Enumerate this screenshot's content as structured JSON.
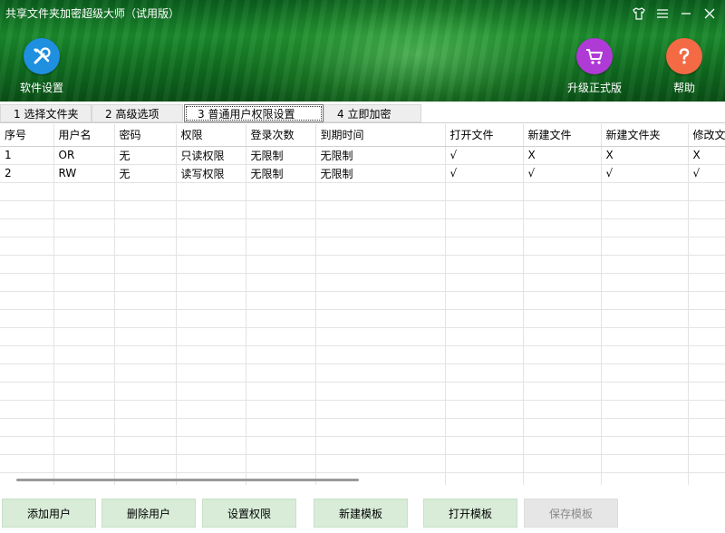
{
  "window": {
    "title": "共享文件夹加密超级大师（试用版）"
  },
  "toolbar": {
    "settings_label": "软件设置",
    "upgrade_label": "升级正式版",
    "help_label": "帮助"
  },
  "tabs": [
    {
      "label": "1 选择文件夹",
      "active": false
    },
    {
      "label": "2 高级选项",
      "active": false
    },
    {
      "label": "3 普通用户权限设置",
      "active": true
    },
    {
      "label": "4 立即加密",
      "active": false
    }
  ],
  "table": {
    "columns": [
      "序号",
      "用户名",
      "密码",
      "权限",
      "登录次数",
      "到期时间",
      "打开文件",
      "新建文件",
      "新建文件夹",
      "修改文件"
    ],
    "rows": [
      [
        "1",
        "OR",
        "无",
        "只读权限",
        "无限制",
        "无限制",
        "√",
        "X",
        "X",
        "X"
      ],
      [
        "2",
        "RW",
        "无",
        "读写权限",
        "无限制",
        "无限制",
        "√",
        "√",
        "√",
        "√"
      ]
    ]
  },
  "buttons": {
    "add_user": "添加用户",
    "delete_user": "删除用户",
    "set_permission": "设置权限",
    "new_template": "新建模板",
    "open_template": "打开模板",
    "save_template": "保存模板"
  },
  "colors": {
    "header_green": "#1a8a2c",
    "settings_icon_bg": "#1f8fe0",
    "upgrade_icon_bg": "#b03ad6",
    "help_icon_bg": "#f36a45",
    "button_bg": "#d8ecd8"
  }
}
